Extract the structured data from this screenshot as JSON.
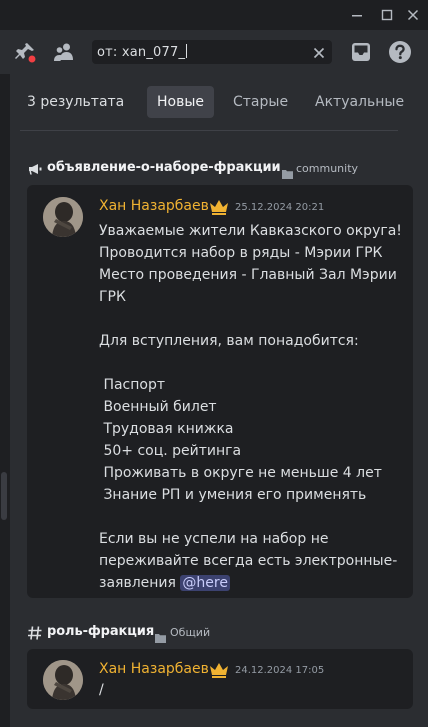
{
  "window": {
    "minimize_icon": "minimize-icon",
    "maximize_icon": "maximize-icon",
    "close_icon": "close-icon"
  },
  "toolbar": {
    "search_value": "от: xan_077_",
    "icons": [
      "pin-alert-icon",
      "members-icon",
      "clear-icon",
      "inbox-icon",
      "help-icon"
    ]
  },
  "results": {
    "count_label": "3 результата",
    "tabs": [
      {
        "label": "Новые",
        "active": true
      },
      {
        "label": "Старые",
        "active": false
      },
      {
        "label": "Актуальные",
        "active": false
      }
    ]
  },
  "groups": [
    {
      "channel_icon": "announcement-icon",
      "channel": "объявление-о-наборе-фракции",
      "category": "community",
      "message": {
        "author": "Хан Назарбаев",
        "timestamp": "25.12.2024 20:21",
        "lines": [
          "Уважаемые жители Кавказского округа!",
          "Проводится набор в ряды - Мэрии ГРК",
          "Место проведения - Главный Зал Мэрии",
          "ГРК",
          "",
          "Для вступления, вам понадобится:",
          "",
          " Паспорт",
          " Военный билет",
          " Трудовая книжка",
          " 50+ соц. рейтинга",
          " Проживать в округе не меньше 4 лет",
          " Знание РП и умения его применять",
          "",
          "Если вы не успели на набор не",
          "переживайте всегда есть электронные-"
        ],
        "last_line_prefix": "заявления ",
        "mention": "@here"
      }
    },
    {
      "channel_icon": "hash-icon",
      "channel": "роль-фракция",
      "category": "Общий",
      "message": {
        "author": "Хан Назарбаев",
        "timestamp": "24.12.2024 17:05",
        "lines": [
          "/"
        ]
      }
    }
  ],
  "colors": {
    "background": "#1e1f22",
    "panel": "#2b2d31",
    "author_name": "#f0b232",
    "mention_bg": "#3c4270"
  }
}
